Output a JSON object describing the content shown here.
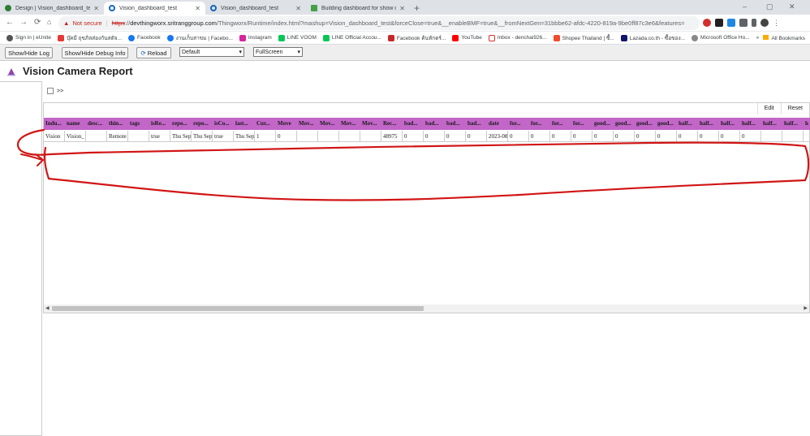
{
  "browser": {
    "tabs": [
      {
        "title": "Design | Vision_dashboard_test",
        "active": false
      },
      {
        "title": "Vision_dashboard_test",
        "active": true
      },
      {
        "title": "Vision_dashboard_test",
        "active": false
      },
      {
        "title": "Building dashboard for show da",
        "active": false
      }
    ],
    "new_tab": "+",
    "window_controls": [
      "–",
      "▢",
      "✕"
    ],
    "address": {
      "security": "Not secure",
      "scheme": "https",
      "host": "devthingworx.sritranggroup.com",
      "path": "/Thingworx/Runtime/index.html?mashup=Vision_dashboard_test&forceClose=true&__enableBMF=true&__fromNextGen=31bbbe62-afdc-4220-819a-9be0ff87c3e6&features="
    },
    "bookmarks": [
      "Sign in | eUnite",
      "บุ๊คมี ถุขภิลส่องกันสตัจ...",
      "Facebook",
      "งานเก็บสาขม | Facebo...",
      "Instagram",
      "LINE VOOM",
      "LINE Official Accou...",
      "Facebook ค้นหักดร์...",
      "YouTube",
      "Inbox - denchai926...",
      "Shopee Thailand | ซื้...",
      "Lazada.co.th - ซื้อของ...",
      "Microsoft Office Ho..."
    ],
    "bookmarks_more": "»",
    "all_bookmarks": "All Bookmarks"
  },
  "toolbar": {
    "show_hide_log": "Show/Hide Log",
    "show_hide_debug": "Show/Hide Debug Info",
    "reload": "Reload",
    "select_default": "Default",
    "select_fullscreen": "FullScreen"
  },
  "app": {
    "title": "Vision Camera Report",
    "checkbox_label": ">>"
  },
  "grid": {
    "edit": "Edit",
    "reset": "Reset",
    "columns": [
      "Indu...",
      "name",
      "desc...",
      "thin...",
      "tags",
      "isRe...",
      "repo...",
      "repo...",
      "isCo...",
      "last...",
      "Cur...",
      "Move",
      "Mov...",
      "Mov...",
      "Mov...",
      "Mov...",
      "Rec...",
      "bad...",
      "bad...",
      "bad...",
      "bad...",
      "date",
      "for...",
      "for...",
      "for...",
      "for...",
      "good...",
      "good...",
      "good...",
      "good...",
      "half...",
      "half...",
      "half...",
      "half...",
      "half...",
      "half...",
      "h"
    ],
    "row": [
      "Vision",
      "Vision_",
      "",
      "Remote",
      "",
      "true",
      "Thu Sep",
      "Thu Sep",
      "true",
      "Thu Sep",
      "1",
      "0",
      "",
      "",
      "",
      "",
      "48975",
      "0",
      "0",
      "0",
      "0",
      "2023-08",
      "0",
      "0",
      "0",
      "0",
      "0",
      "0",
      "0",
      "0",
      "0",
      "0",
      "0",
      "0",
      "",
      "",
      ""
    ]
  },
  "colors": {
    "header_bg": "#c266c8",
    "annotation": "#d11515"
  }
}
